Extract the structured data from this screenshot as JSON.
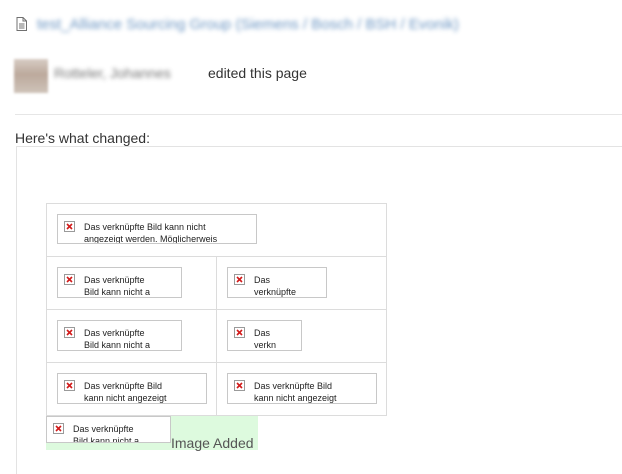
{
  "header": {
    "page_title": "test_Alliance Sourcing Group (Siemens / Bosch / BSH / Evonik)",
    "page_icon": "page-icon"
  },
  "activity": {
    "author": "Rotteler, Johannes",
    "action": "edited this page",
    "avatar_icon": "avatar"
  },
  "changes": {
    "heading": "Here's what changed:",
    "broken_image_icon": "broken-image-icon",
    "broken_image_text_full": "Das verknüpfte Bild kann nicht angezeigt werden. Möglicherweise",
    "cells": [
      {
        "line1": "Das verknüpfte Bild kann nicht",
        "line2": "angezeigt werden. Möglicherweis"
      },
      {
        "line1": "Das verknüpfte",
        "line2": "Bild kann nicht a"
      },
      {
        "line1": "Das",
        "line2": "verknüpfte"
      },
      {
        "line1": "Das verknüpfte",
        "line2": "Bild kann nicht a"
      },
      {
        "line1": "Das",
        "line2": "verkn"
      },
      {
        "line1": "Das verknüpfte Bild",
        "line2": "kann nicht angezeigt"
      },
      {
        "line1": "Das verknüpfte Bild",
        "line2": "kann nicht angezeigt"
      }
    ],
    "added_image": {
      "line1": "Das verknüpfte",
      "line2": "Bild kann nicht a"
    },
    "added_label": "Image Added",
    "added_color": "#ddfade",
    "link_color": "#3b73af"
  }
}
